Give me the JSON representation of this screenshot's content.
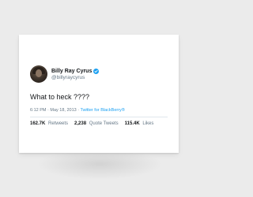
{
  "tweet": {
    "display_name": "Billy Ray Cyrus",
    "handle": "@billyraycyrus",
    "verified_icon": "verified-badge-icon",
    "text": "What to heck ????",
    "time": "6:12 PM",
    "date": "May 18, 2013",
    "separator": "·",
    "source": "Twitter for BlackBerry®",
    "stats": [
      {
        "value": "162.7K",
        "label": "Retweets"
      },
      {
        "value": "2,238",
        "label": "Quote Tweets"
      },
      {
        "value": "115.4K",
        "label": "Likes"
      }
    ]
  },
  "colors": {
    "background": "#ebebeb",
    "poster": "#ffffff",
    "verified": "#1da1f2",
    "text": "#14171a",
    "muted": "#657786"
  }
}
